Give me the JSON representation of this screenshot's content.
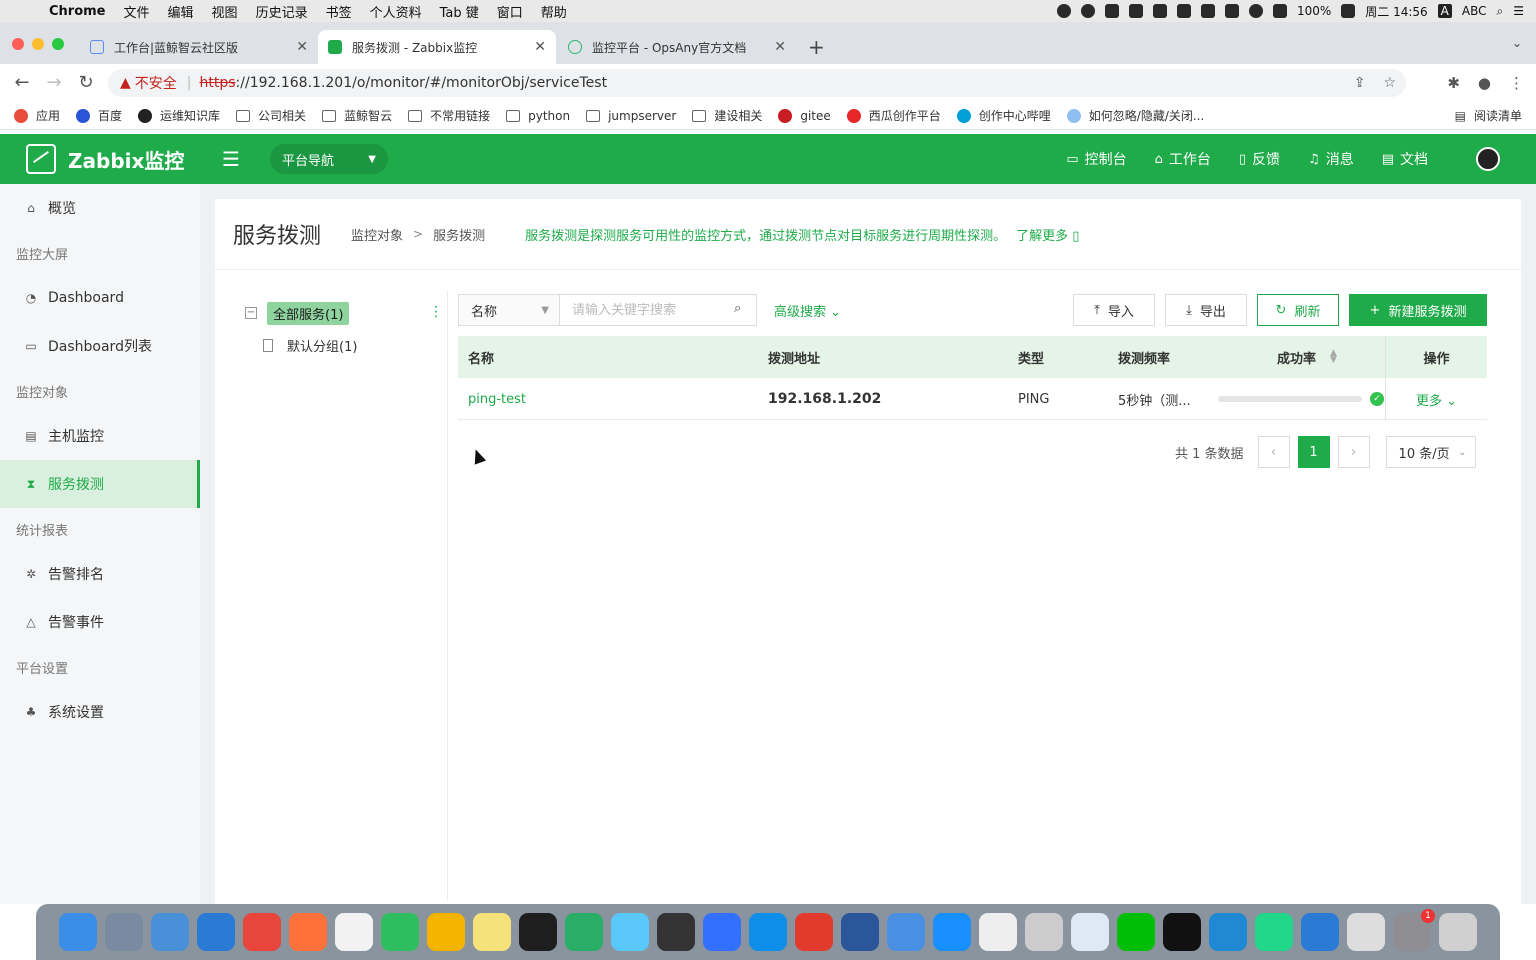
{
  "menubar": {
    "apple": "",
    "app_name": "Chrome",
    "items": [
      "文件",
      "编辑",
      "视图",
      "历史记录",
      "书签",
      "个人资料",
      "Tab 键",
      "窗口",
      "帮助"
    ],
    "battery": "100%",
    "clock": "周二 14:56",
    "input_method_letter": "A",
    "input_method": "ABC"
  },
  "tabs": [
    {
      "title": "工作台|蓝鲸智云社区版",
      "icon": "cloud-icon",
      "color": "#5b8def"
    },
    {
      "title": "服务拨测 - Zabbix监控",
      "icon": "zabbix-favicon",
      "color": "#1fab4a"
    },
    {
      "title": "监控平台 - OpsAny官方文档",
      "icon": "opsany-icon",
      "color": "#2eb872"
    }
  ],
  "address": {
    "warning": "不安全",
    "scheme": "https",
    "url": "://192.168.1.201/o/monitor/#/monitorObj/serviceTest"
  },
  "bookmarks": [
    {
      "label": "应用",
      "icon": "apps-grid-icon",
      "color": "#e74c3c"
    },
    {
      "label": "百度",
      "icon": "baidu-icon",
      "color": "#2b55d9"
    },
    {
      "label": "运维知识库",
      "icon": "github-icon",
      "color": "#222"
    },
    {
      "label": "公司相关",
      "icon": "folder-icon",
      "color": "#666"
    },
    {
      "label": "蓝鲸智云",
      "icon": "folder-icon",
      "color": "#666"
    },
    {
      "label": "不常用链接",
      "icon": "folder-icon",
      "color": "#666"
    },
    {
      "label": "python",
      "icon": "folder-icon",
      "color": "#666"
    },
    {
      "label": "jumpserver",
      "icon": "folder-icon",
      "color": "#666"
    },
    {
      "label": "建设相关",
      "icon": "folder-icon",
      "color": "#666"
    },
    {
      "label": "gitee",
      "icon": "gitee-icon",
      "color": "#c71d23"
    },
    {
      "label": "西瓜创作平台",
      "icon": "xigua-icon",
      "color": "#e8272a"
    },
    {
      "label": "创作中心哔哩",
      "icon": "bilibili-icon",
      "color": "#00a1d6"
    },
    {
      "label": "如何忽略/隐藏/关闭...",
      "icon": "bubble-icon",
      "color": "#8fbff0"
    }
  ],
  "reading_list": "阅读清单",
  "header": {
    "app_title": "Zabbix监控",
    "platform_nav": "平台导航",
    "links": [
      {
        "label": "控制台",
        "icon": "monitor-icon"
      },
      {
        "label": "工作台",
        "icon": "home-icon"
      },
      {
        "label": "反馈",
        "icon": "file-icon"
      },
      {
        "label": "消息",
        "icon": "bell-icon"
      },
      {
        "label": "文档",
        "icon": "doc-icon"
      }
    ],
    "brand_color": "#1fab4a"
  },
  "sidebar": {
    "items": [
      {
        "type": "item",
        "label": "概览",
        "icon": "home-icon",
        "glyph": "⌂"
      },
      {
        "type": "group",
        "label": "监控大屏"
      },
      {
        "type": "item",
        "label": "Dashboard",
        "icon": "dashboard-icon",
        "glyph": "◔"
      },
      {
        "type": "item",
        "label": "Dashboard列表",
        "icon": "list-icon",
        "glyph": "▭"
      },
      {
        "type": "group",
        "label": "监控对象"
      },
      {
        "type": "item",
        "label": "主机监控",
        "icon": "host-icon",
        "glyph": "▤"
      },
      {
        "type": "item",
        "label": "服务拨测",
        "icon": "hourglass-icon",
        "glyph": "⧗",
        "active": true
      },
      {
        "type": "group",
        "label": "统计报表"
      },
      {
        "type": "item",
        "label": "告警排名",
        "icon": "bug-icon",
        "glyph": "✲"
      },
      {
        "type": "item",
        "label": "告警事件",
        "icon": "warning-icon",
        "glyph": "△"
      },
      {
        "type": "group",
        "label": "平台设置"
      },
      {
        "type": "item",
        "label": "系统设置",
        "icon": "settings-tree-icon",
        "glyph": "♣"
      }
    ]
  },
  "page": {
    "title": "服务拨测",
    "breadcrumb": [
      "监控对象",
      "服务拨测"
    ],
    "description": "服务拨测是探测服务可用性的监控方式，通过拨测节点对目标服务进行周期性探测。",
    "learn_more": "了解更多"
  },
  "tree": {
    "root": "全部服务(1)",
    "children": [
      "默认分组(1)"
    ]
  },
  "toolbar": {
    "field": "名称",
    "search_placeholder": "请输入关键字搜索",
    "advanced": "高级搜索",
    "import": "导入",
    "export": "导出",
    "refresh": "刷新",
    "create": "新建服务拨测"
  },
  "table": {
    "columns": [
      "名称",
      "拨测地址",
      "类型",
      "拨测频率",
      "成功率",
      "操作"
    ],
    "rows": [
      {
        "name": "ping-test",
        "address": "192.168.1.202",
        "type": "PING",
        "frequency": "5秒钟（测...",
        "success_rate": 1.0,
        "action": "更多"
      }
    ]
  },
  "pagination": {
    "total": "共 1 条数据",
    "current": "1",
    "page_size": "10 条/页"
  },
  "dock": {
    "apps": [
      {
        "name": "finder-icon",
        "color": "#3b8ee8"
      },
      {
        "name": "launchpad-icon",
        "color": "#7a8aa0"
      },
      {
        "name": "netease-icon",
        "color": "#4a90d9"
      },
      {
        "name": "safari-icon",
        "color": "#2a7ad5"
      },
      {
        "name": "chrome-icon",
        "color": "#e8453c"
      },
      {
        "name": "firefox-icon",
        "color": "#ff7139"
      },
      {
        "name": "typora-icon",
        "color": "#f2f2f2"
      },
      {
        "name": "evernote-icon",
        "color": "#2dbe60"
      },
      {
        "name": "photos-icon",
        "color": "#f5b400"
      },
      {
        "name": "notes-icon",
        "color": "#f6e27a"
      },
      {
        "name": "qq-icon",
        "color": "#1e1e1e"
      },
      {
        "name": "wechat-icon",
        "color": "#2aae67"
      },
      {
        "name": "messages-icon",
        "color": "#5ac8fa"
      },
      {
        "name": "terminal-zen-icon",
        "color": "#333333"
      },
      {
        "name": "lark-icon",
        "color": "#3370ff"
      },
      {
        "name": "teamviewer-icon",
        "color": "#0e8ee9"
      },
      {
        "name": "wps-icon",
        "color": "#e23b2e"
      },
      {
        "name": "word-icon",
        "color": "#2b579a"
      },
      {
        "name": "kingsoft-icon",
        "color": "#4a90e2"
      },
      {
        "name": "dingtalk-icon",
        "color": "#1890ff"
      },
      {
        "name": "textedit-icon",
        "color": "#eeeeee"
      },
      {
        "name": "snail-icon",
        "color": "#cccccc"
      },
      {
        "name": "baidu-disk-icon",
        "color": "#dfe8f5"
      },
      {
        "name": "iqiyi-icon",
        "color": "#00be06"
      },
      {
        "name": "terminal-icon",
        "color": "#111111"
      },
      {
        "name": "vscode-icon",
        "color": "#1f8ad2"
      },
      {
        "name": "pycharm-icon",
        "color": "#21d789"
      },
      {
        "name": "quicktime-icon",
        "color": "#2b7bd6"
      },
      {
        "name": "pages-icon",
        "color": "#dddddd"
      },
      {
        "name": "system-preferences-icon",
        "color": "#8e8e93",
        "badge": "1"
      },
      {
        "name": "trash-icon",
        "color": "#d0d0d0"
      }
    ]
  }
}
